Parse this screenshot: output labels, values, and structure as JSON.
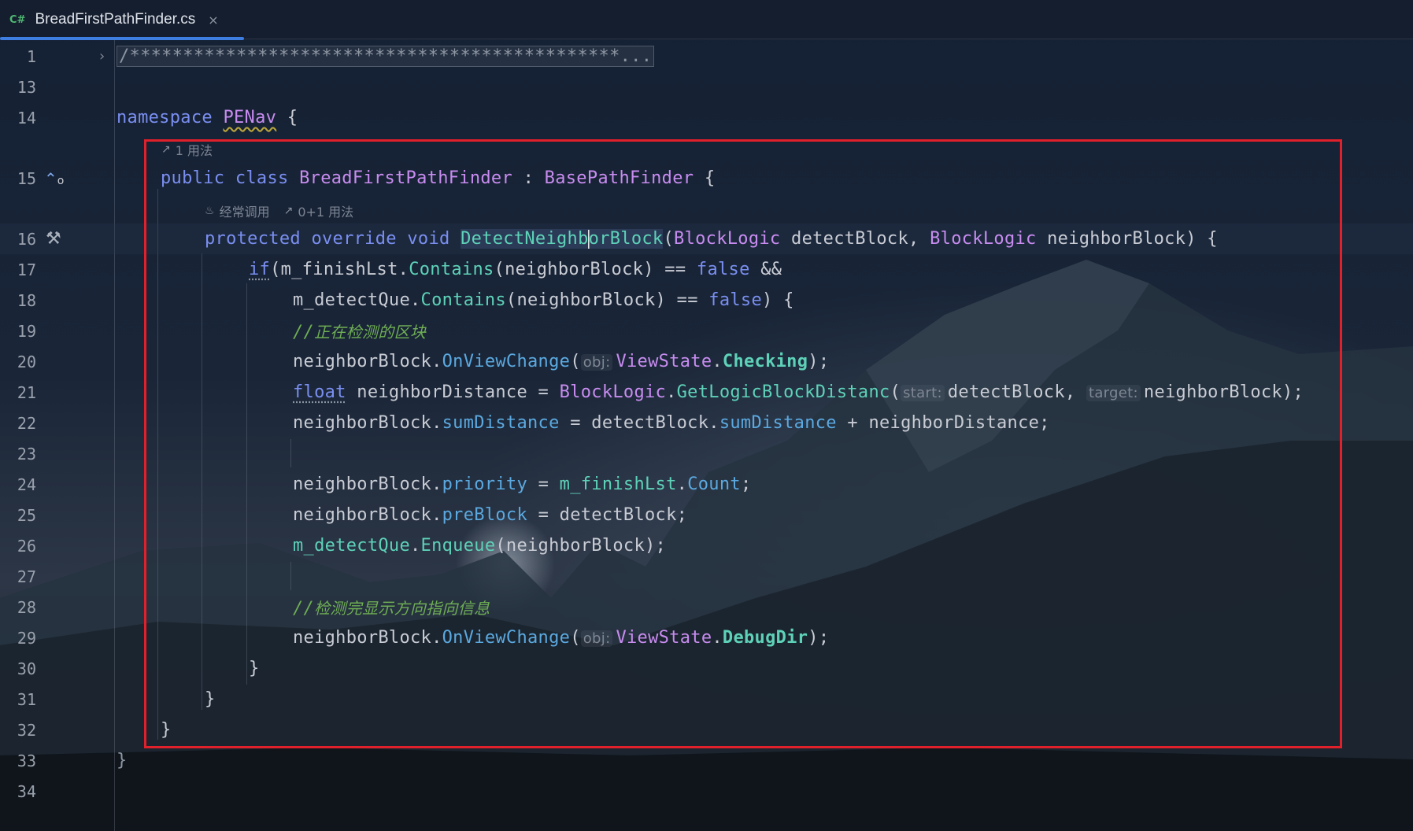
{
  "tab": {
    "lang_badge": "C#",
    "file_name": "BreadFirstPathFinder.cs",
    "close_glyph": "×"
  },
  "hints": {
    "class_usages": "1 用法",
    "method_frequent": "经常调用",
    "method_usages": "0+1 用法"
  },
  "line_numbers": [
    "1",
    "13",
    "14",
    "15",
    "16",
    "17",
    "18",
    "19",
    "20",
    "21",
    "22",
    "23",
    "24",
    "25",
    "26",
    "27",
    "28",
    "29",
    "30",
    "31",
    "32",
    "33",
    "34"
  ],
  "code": {
    "l1_fold": "/**********************************************...",
    "l14_kw": "namespace",
    "l14_ns": "PENav",
    "l15_public": "public",
    "l15_class": "class",
    "l15_name": "BreadFirstPathFinder",
    "l15_colon": ":",
    "l15_base": "BasePathFinder",
    "l16_protected": "protected",
    "l16_override": "override",
    "l16_void": "void",
    "l16_method_a": "DetectNeighb",
    "l16_method_b": "orBlock",
    "l16_type1": "BlockLogic",
    "l16_param1": "detectBlock,",
    "l16_type2": "BlockLogic",
    "l16_param2": "neighborBlock) {",
    "l17_if": "if",
    "l17_obj": "m_finishLst",
    "l17_method": "Contains",
    "l17_args": "(neighborBlock) ==",
    "l17_false": "false",
    "l17_and": "&&",
    "l18_obj": "m_detectQue",
    "l18_method": "Contains",
    "l18_args": "(neighborBlock) ==",
    "l18_false": "false",
    "l18_end": ") {",
    "l19_comment_slash": "//",
    "l19_comment": "正在检测的区块",
    "l20_obj": "neighborBlock",
    "l20_method": "OnViewChange",
    "l20_hint": "obj:",
    "l20_type": "ViewState",
    "l20_member": "Checking",
    "l21_float": "float",
    "l21_var": "neighborDistance =",
    "l21_type": "BlockLogic",
    "l21_method": "GetLogicBlockDistanc",
    "l21_hint1": "start:",
    "l21_arg1": "detectBlock,",
    "l21_hint2": "target:",
    "l21_arg2": "neighborBlock);",
    "l22_obj": "neighborBlock",
    "l22_prop": "sumDistance",
    "l22_eq": "= detectBlock.",
    "l22_prop2": "sumDistance",
    "l22_rest": "+ neighborDistance;",
    "l24_obj": "neighborBlock",
    "l24_prop": "priority",
    "l24_eq": "=",
    "l24_obj2": "m_finishLst",
    "l24_prop2": "Count",
    "l25_obj": "neighborBlock",
    "l25_prop": "preBlock",
    "l25_rest": "= detectBlock;",
    "l26_obj": "m_detectQue",
    "l26_method": "Enqueue",
    "l26_rest": "(neighborBlock);",
    "l28_comment_slash": "//",
    "l28_comment": "检测完显示方向指向信息",
    "l29_obj": "neighborBlock",
    "l29_method": "OnViewChange",
    "l29_hint": "obj:",
    "l29_type": "ViewState",
    "l29_member": "DebugDir",
    "brace_close": "}",
    "brace_open": "{"
  },
  "colors": {
    "keyword": "#7a8ef0",
    "type": "#c88cf0",
    "method": "#5ed2b8",
    "property": "#5ba9e0",
    "comment": "#6fae54",
    "highlight_box": "#e0202a",
    "tab_underline": "#3d7ee0"
  },
  "icons": [
    "fold-arrow-icon",
    "implements-icon",
    "hammer-icon",
    "close-icon",
    "usages-icon",
    "frequent-icon"
  ]
}
